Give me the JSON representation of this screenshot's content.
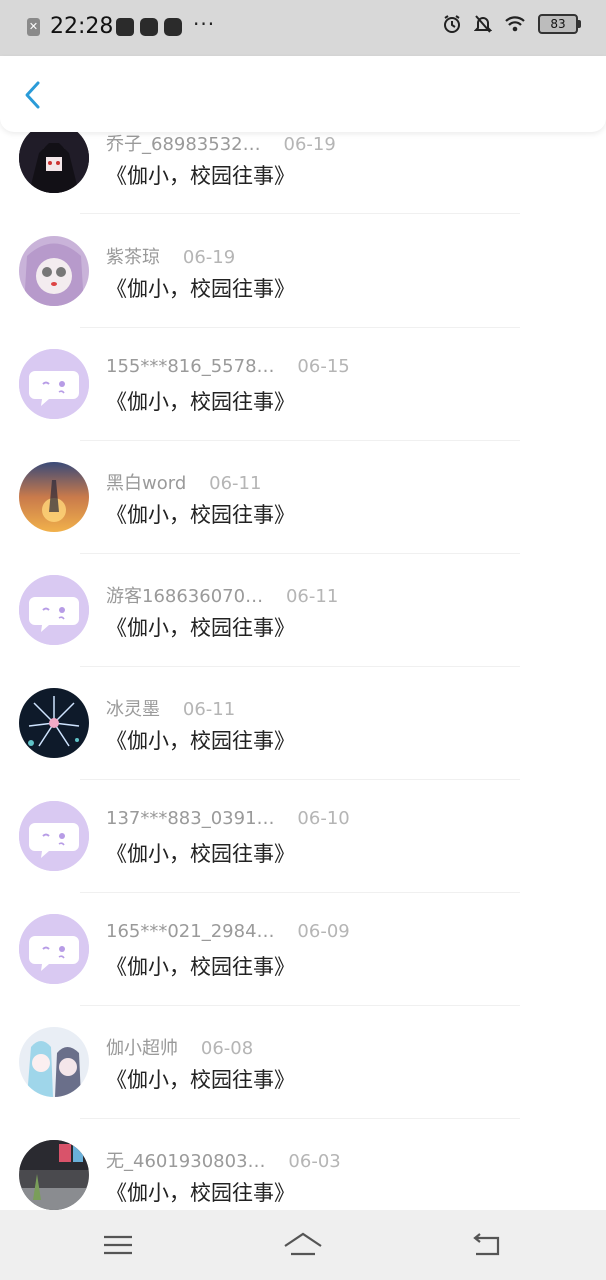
{
  "status_bar": {
    "time": "22:28",
    "dots": "···",
    "battery": "83"
  },
  "header": {
    "back_icon": "chevron-left-icon"
  },
  "items": [
    {
      "name": "乔子_68983532…",
      "date": "06-19",
      "title": "《伽小，校园往事》",
      "avatar": "dark-hair-girl"
    },
    {
      "name": "紫茶琼",
      "date": "06-19",
      "title": "《伽小，校园往事》",
      "avatar": "purple-hair-girl"
    },
    {
      "name": "155***816_5578…",
      "date": "06-15",
      "title": "《伽小，校园往事》",
      "avatar": "default-chat-icon"
    },
    {
      "name": "黑白word",
      "date": "06-11",
      "title": "《伽小，校园往事》",
      "avatar": "sunset-girl"
    },
    {
      "name": "游客168636070…",
      "date": "06-11",
      "title": "《伽小，校园往事》",
      "avatar": "default-chat-icon"
    },
    {
      "name": "冰灵墨",
      "date": "06-11",
      "title": "《伽小，校园往事》",
      "avatar": "flower-night"
    },
    {
      "name": "137***883_0391…",
      "date": "06-10",
      "title": "《伽小，校园往事》",
      "avatar": "default-chat-icon"
    },
    {
      "name": "165***021_2984…",
      "date": "06-09",
      "title": "《伽小，校园往事》",
      "avatar": "default-chat-icon"
    },
    {
      "name": "伽小超帅",
      "date": "06-08",
      "title": "《伽小，校园往事》",
      "avatar": "anime-pair"
    },
    {
      "name": "无_4601930803…",
      "date": "06-03",
      "title": "《伽小，校园往事》",
      "avatar": "street-photo"
    }
  ],
  "navbar": {
    "menu_icon": "menu-icon",
    "home_icon": "home-icon",
    "back_icon": "back-icon"
  },
  "colors": {
    "accent": "#2a9bd8",
    "default_avatar_bg": "#d9c9f2",
    "default_avatar_fg": "#b79ce6"
  }
}
